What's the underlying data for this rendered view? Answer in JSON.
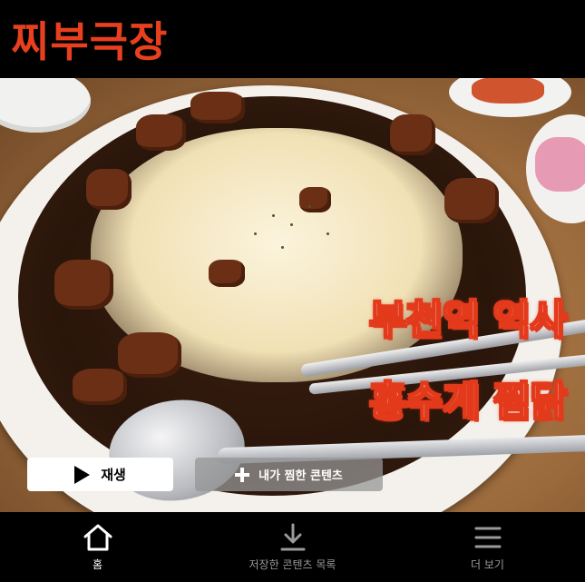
{
  "app": {
    "logo_text": "찌부극장",
    "brand_color": "#e8401f"
  },
  "hero": {
    "title_line1": "부천역 역사",
    "title_line2": "홍수계 찜닭",
    "title_color": "#ffffff",
    "title_outline_color": "#e33a1c"
  },
  "actions": {
    "play_label": "재생",
    "play_icon": "play-icon",
    "my_list_label": "내가 찜한 콘텐츠",
    "my_list_icon": "plus-icon"
  },
  "bottom_nav": {
    "items": [
      {
        "label": "홈",
        "icon": "home-icon",
        "active": true
      },
      {
        "label": "저장한 콘텐츠 목록",
        "icon": "download-icon",
        "active": false
      },
      {
        "label": "더 보기",
        "icon": "menu-icon",
        "active": false
      }
    ]
  }
}
